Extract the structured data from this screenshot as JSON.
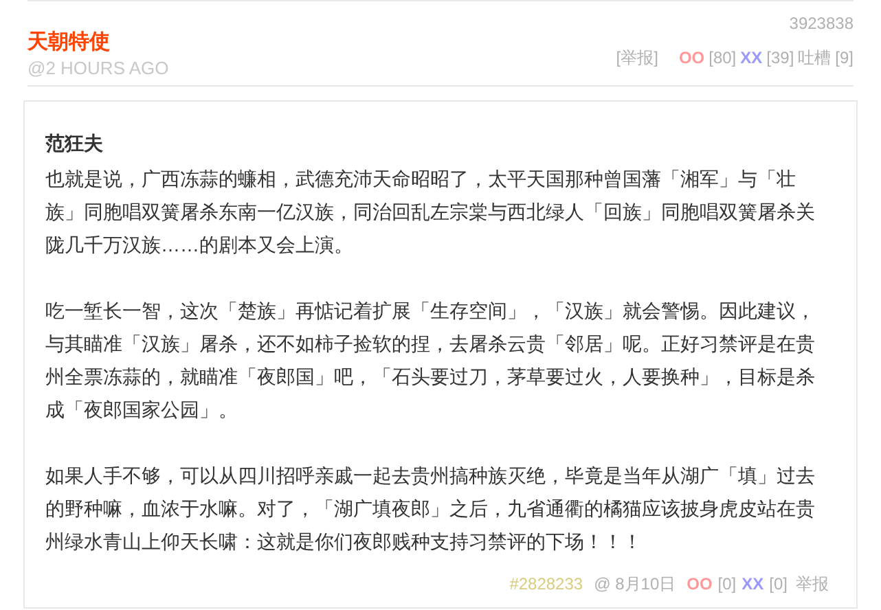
{
  "post": {
    "number": "3923838",
    "author": "天朝特使",
    "time": "@2 HOURS AGO",
    "actions": [
      {
        "kind": "report",
        "label": "[举报]"
      },
      {
        "kind": "oo",
        "label": "OO"
      },
      {
        "kind": "count",
        "label": "[80]"
      },
      {
        "kind": "xx",
        "label": "XX"
      },
      {
        "kind": "count",
        "label": "[39]"
      },
      {
        "kind": "tucao",
        "label": "吐槽"
      },
      {
        "kind": "count",
        "label": "[9]"
      }
    ]
  },
  "comment": {
    "author": "范狂夫",
    "paragraphs": [
      "也就是说，广西冻蒜的蠊相，武德充沛天命昭昭了，太平天国那种曾国藩「湘军」与「壮族」同胞唱双簧屠杀东南一亿汉族，同治回乱左宗棠与西北绿人「回族」同胞唱双簧屠杀关陇几千万汉族……的剧本又会上演。",
      "吃一堑长一智，这次「楚族」再惦记着扩展「生存空间」，「汉族」就会警惕。因此建议，与其瞄准「汉族」屠杀，还不如柿子捡软的捏，去屠杀云贵「邻居」呢。正好习禁评是在贵州全票冻蒜的，就瞄准「夜郎国」吧，「石头要过刀，茅草要过火，人要换种」，目标是杀成「夜郎国家公园」。",
      "如果人手不够，可以从四川招呼亲戚一起去贵州搞种族灭绝，毕竟是当年从湖广「填」过去的野种嘛，血浓于水嘛。对了，「湖广填夜郎」之后，九省通衢的橘猫应该披身虎皮站在贵州绿水青山上仰天长啸：这就是你们夜郎贱种支持习禁评的下场！！！"
    ],
    "footer": [
      {
        "kind": "hash",
        "label": "#2828233"
      },
      {
        "kind": "date",
        "label": "@ 8月10日"
      },
      {
        "kind": "oo",
        "label": "OO"
      },
      {
        "kind": "count",
        "label": "[0]"
      },
      {
        "kind": "xx",
        "label": "XX"
      },
      {
        "kind": "count",
        "label": "[0]"
      },
      {
        "kind": "report",
        "label": "举报"
      }
    ]
  }
}
